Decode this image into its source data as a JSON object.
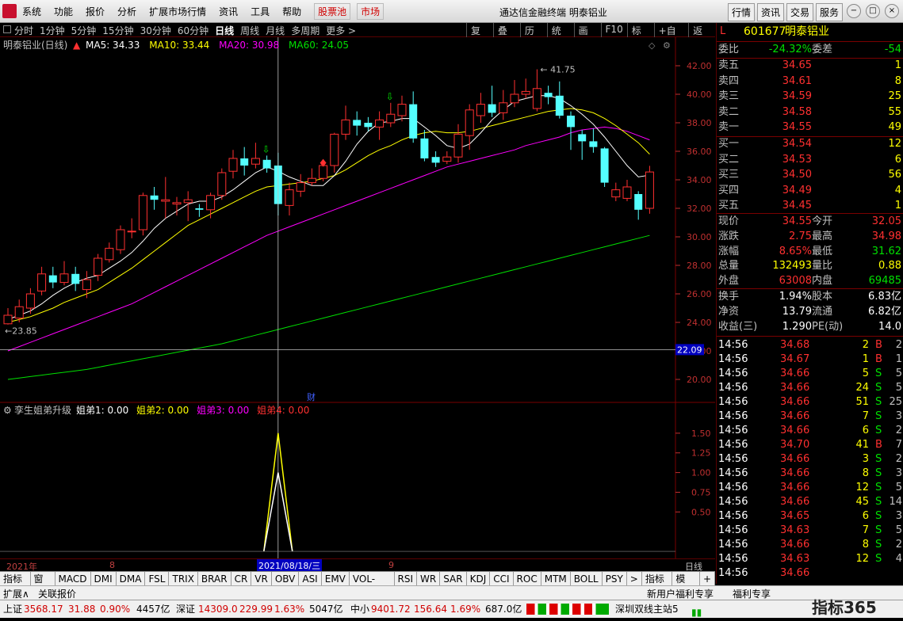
{
  "menu": {
    "items": [
      "系统",
      "功能",
      "报价",
      "分析",
      "扩展市场行情",
      "资讯",
      "工具",
      "帮助"
    ],
    "red_items": [
      "股票池",
      "市场"
    ],
    "app_title": "通达信金融终端  明泰铝业",
    "right_buttons": [
      "行情",
      "资讯",
      "交易",
      "服务"
    ]
  },
  "periods": {
    "items": [
      "分时",
      "1分钟",
      "5分钟",
      "15分钟",
      "30分钟",
      "60分钟",
      "日线",
      "周线",
      "月线",
      "多周期",
      "更多 >"
    ],
    "active": "日线",
    "tools": [
      "复权",
      "叠加",
      "历史",
      "统计",
      "画线",
      "F10",
      "标记",
      "+自选",
      "返回"
    ]
  },
  "chart_header": {
    "name": "明泰铝业(日线)",
    "ma5": "MA5: 34.33",
    "ma10": "MA10: 33.44",
    "ma20": "MA20: 30.98",
    "ma60": "MA60: 24.05"
  },
  "chart_data": [
    {
      "type": "candlestick",
      "title": "明泰铝业(日线)",
      "y_ticks": [
        "42.00",
        "40.00",
        "38.00",
        "36.00",
        "34.00",
        "32.00",
        "30.00",
        "28.00",
        "26.00",
        "24.00",
        "22.00",
        "20.00"
      ],
      "ylim": [
        19.0,
        43.0
      ],
      "cursor_price": "22.09",
      "high_label": "41.75",
      "low_label": "23.85",
      "event_label": "财",
      "x_labels": [
        "2021年",
        "8",
        "9"
      ],
      "cursor_date": "2021/08/18/三",
      "candles": [
        {
          "o": 23.9,
          "c": 24.5,
          "h": 25.0,
          "l": 23.85
        },
        {
          "o": 24.3,
          "c": 25.1,
          "h": 25.6,
          "l": 24.0
        },
        {
          "o": 25.0,
          "c": 26.0,
          "h": 26.4,
          "l": 24.6
        },
        {
          "o": 26.2,
          "c": 27.4,
          "h": 27.9,
          "l": 25.9
        },
        {
          "o": 27.3,
          "c": 26.8,
          "h": 27.9,
          "l": 26.4
        },
        {
          "o": 26.8,
          "c": 27.4,
          "h": 28.3,
          "l": 26.6
        },
        {
          "o": 27.4,
          "c": 26.7,
          "h": 27.9,
          "l": 26.2
        },
        {
          "o": 26.3,
          "c": 27.0,
          "h": 27.6,
          "l": 25.7
        },
        {
          "o": 27.3,
          "c": 28.5,
          "h": 28.8,
          "l": 26.9
        },
        {
          "o": 28.4,
          "c": 29.2,
          "h": 29.6,
          "l": 28.2
        },
        {
          "o": 29.1,
          "c": 30.5,
          "h": 30.8,
          "l": 28.8
        },
        {
          "o": 30.4,
          "c": 30.4,
          "h": 31.3,
          "l": 29.9
        },
        {
          "o": 30.5,
          "c": 32.9,
          "h": 33.1,
          "l": 30.1
        },
        {
          "o": 32.9,
          "c": 32.6,
          "h": 33.5,
          "l": 31.9
        },
        {
          "o": 32.5,
          "c": 32.6,
          "h": 34.2,
          "l": 31.3
        },
        {
          "o": 32.3,
          "c": 32.4,
          "h": 32.8,
          "l": 31.5
        },
        {
          "o": 32.4,
          "c": 32.6,
          "h": 33.2,
          "l": 31.1
        },
        {
          "o": 32.0,
          "c": 31.9,
          "h": 32.3,
          "l": 31.4
        },
        {
          "o": 31.9,
          "c": 32.9,
          "h": 33.1,
          "l": 31.3
        },
        {
          "o": 32.9,
          "c": 34.5,
          "h": 34.8,
          "l": 32.6
        },
        {
          "o": 34.6,
          "c": 35.5,
          "h": 36.1,
          "l": 34.1
        },
        {
          "o": 35.5,
          "c": 35.0,
          "h": 36.3,
          "l": 34.3
        },
        {
          "o": 35.1,
          "c": 35.5,
          "h": 36.6,
          "l": 34.8
        },
        {
          "o": 35.4,
          "c": 34.8,
          "h": 35.7,
          "l": 34.5
        },
        {
          "o": 35.0,
          "c": 32.3,
          "h": 35.9,
          "l": 31.5
        },
        {
          "o": 32.2,
          "c": 33.3,
          "h": 33.8,
          "l": 31.5
        },
        {
          "o": 33.2,
          "c": 33.8,
          "h": 34.4,
          "l": 32.8
        },
        {
          "o": 33.8,
          "c": 34.1,
          "h": 34.8,
          "l": 33.6
        },
        {
          "o": 34.1,
          "c": 35.0,
          "h": 35.3,
          "l": 33.9
        },
        {
          "o": 35.0,
          "c": 37.2,
          "h": 37.3,
          "l": 34.5
        },
        {
          "o": 37.2,
          "c": 38.2,
          "h": 39.2,
          "l": 36.8
        },
        {
          "o": 38.2,
          "c": 37.8,
          "h": 38.8,
          "l": 37.1
        },
        {
          "o": 38.0,
          "c": 37.7,
          "h": 38.4,
          "l": 37.4
        },
        {
          "o": 37.7,
          "c": 38.2,
          "h": 38.8,
          "l": 36.8
        },
        {
          "o": 38.0,
          "c": 38.6,
          "h": 39.4,
          "l": 37.7
        },
        {
          "o": 38.5,
          "c": 39.3,
          "h": 39.9,
          "l": 38.1
        },
        {
          "o": 39.3,
          "c": 36.9,
          "h": 40.2,
          "l": 36.6
        },
        {
          "o": 36.9,
          "c": 35.5,
          "h": 37.5,
          "l": 35.3
        },
        {
          "o": 35.6,
          "c": 35.2,
          "h": 36.0,
          "l": 34.9
        },
        {
          "o": 35.3,
          "c": 35.6,
          "h": 36.0,
          "l": 35.1
        },
        {
          "o": 35.6,
          "c": 37.2,
          "h": 37.9,
          "l": 35.2
        },
        {
          "o": 37.1,
          "c": 38.9,
          "h": 39.3,
          "l": 36.1
        },
        {
          "o": 38.5,
          "c": 39.3,
          "h": 40.1,
          "l": 38.0
        },
        {
          "o": 39.3,
          "c": 38.7,
          "h": 40.6,
          "l": 38.4
        },
        {
          "o": 38.7,
          "c": 39.4,
          "h": 40.3,
          "l": 38.2
        },
        {
          "o": 39.4,
          "c": 40.0,
          "h": 41.0,
          "l": 39.1
        },
        {
          "o": 40.0,
          "c": 40.2,
          "h": 41.1,
          "l": 39.7
        },
        {
          "o": 39.0,
          "c": 40.4,
          "h": 41.75,
          "l": 38.8
        },
        {
          "o": 40.1,
          "c": 39.8,
          "h": 40.6,
          "l": 39.3
        },
        {
          "o": 39.9,
          "c": 38.5,
          "h": 40.9,
          "l": 38.3
        },
        {
          "o": 38.5,
          "c": 37.7,
          "h": 38.8,
          "l": 36.1
        },
        {
          "o": 37.2,
          "c": 36.7,
          "h": 37.5,
          "l": 35.4
        },
        {
          "o": 36.7,
          "c": 36.3,
          "h": 37.6,
          "l": 35.9
        },
        {
          "o": 36.2,
          "c": 33.8,
          "h": 36.3,
          "l": 33.5
        },
        {
          "o": 32.8,
          "c": 33.3,
          "h": 33.8,
          "l": 32.5
        },
        {
          "o": 32.7,
          "c": 33.5,
          "h": 34.0,
          "l": 32.5
        },
        {
          "o": 33.0,
          "c": 31.9,
          "h": 33.2,
          "l": 31.2
        },
        {
          "o": 32.0,
          "c": 34.55,
          "h": 34.98,
          "l": 31.62
        }
      ],
      "ma5": [
        24.2,
        24.5,
        24.8,
        25.3,
        25.9,
        26.4,
        26.8,
        27.1,
        27.3,
        27.8,
        28.3,
        28.9,
        29.7,
        30.6,
        31.3,
        31.8,
        32.3,
        32.5,
        32.5,
        32.8,
        33.3,
        33.9,
        34.5,
        34.9,
        34.6,
        34.2,
        33.9,
        33.6,
        33.6,
        34.3,
        35.3,
        36.5,
        37.4,
        38.0,
        38.1,
        38.3,
        38.3,
        37.7,
        37.1,
        36.4,
        36.2,
        36.5,
        37.3,
        38.2,
        38.9,
        39.5,
        39.7,
        39.9,
        39.9,
        39.7,
        39.2,
        38.6,
        37.9,
        37.0,
        36.0,
        35.0,
        34.2,
        34.33
      ],
      "ma10": [
        24.0,
        24.2,
        24.4,
        24.7,
        25.0,
        25.4,
        25.7,
        26.0,
        26.3,
        26.8,
        27.3,
        27.8,
        28.4,
        29.0,
        29.6,
        30.2,
        30.8,
        31.2,
        31.6,
        32.0,
        32.4,
        32.8,
        33.2,
        33.5,
        33.6,
        33.7,
        33.8,
        33.9,
        34.1,
        34.3,
        34.7,
        35.2,
        35.7,
        36.1,
        36.4,
        36.8,
        37.1,
        37.3,
        37.4,
        37.3,
        37.3,
        37.4,
        37.6,
        37.8,
        38.0,
        38.2,
        38.4,
        38.6,
        38.8,
        38.9,
        39.0,
        38.9,
        38.7,
        38.3,
        37.8,
        37.2,
        36.6,
        35.8
      ],
      "ma20": [
        22.0,
        22.3,
        22.6,
        22.9,
        23.2,
        23.5,
        23.8,
        24.1,
        24.4,
        24.7,
        25.0,
        25.3,
        25.7,
        26.1,
        26.5,
        26.9,
        27.3,
        27.7,
        28.1,
        28.5,
        28.9,
        29.3,
        29.7,
        30.1,
        30.4,
        30.7,
        31.0,
        31.3,
        31.6,
        31.9,
        32.2,
        32.5,
        32.8,
        33.1,
        33.4,
        33.7,
        34.0,
        34.3,
        34.6,
        34.9,
        35.1,
        35.3,
        35.5,
        35.7,
        35.9,
        36.1,
        36.4,
        36.6,
        36.8,
        37.0,
        37.3,
        37.5,
        37.6,
        37.7,
        37.6,
        37.4,
        37.1,
        36.8
      ],
      "ma60": [
        20.0,
        20.1,
        20.2,
        20.3,
        20.4,
        20.5,
        20.6,
        20.7,
        20.85,
        21.0,
        21.15,
        21.3,
        21.45,
        21.6,
        21.75,
        21.9,
        22.05,
        22.2,
        22.35,
        22.5,
        22.7,
        22.9,
        23.1,
        23.3,
        23.5,
        23.7,
        23.9,
        24.1,
        24.3,
        24.5,
        24.7,
        24.9,
        25.1,
        25.3,
        25.5,
        25.7,
        25.9,
        26.1,
        26.3,
        26.5,
        26.7,
        26.9,
        27.1,
        27.3,
        27.5,
        27.7,
        27.9,
        28.1,
        28.3,
        28.5,
        28.7,
        28.9,
        29.1,
        29.3,
        29.5,
        29.7,
        29.9,
        30.1
      ]
    },
    {
      "type": "line",
      "title": "孪生姐弟升级",
      "legend": [
        "姐弟1: 0.00",
        "姐弟2: 0.00",
        "姐弟3: 0.00",
        "姐弟4: 0.00"
      ],
      "y_ticks": [
        "1.50",
        "1.25",
        "1.00",
        "0.75",
        "0.50"
      ],
      "ylim": [
        -0.05,
        1.7
      ],
      "spike_index": 24,
      "series": [
        {
          "name": "姐弟2",
          "values": [
            0,
            1.5,
            0
          ],
          "color": "#ffff00"
        },
        {
          "name": "姐弟1",
          "values": [
            0,
            1.0,
            0
          ],
          "color": "#ffffff"
        }
      ]
    }
  ],
  "quote": {
    "code": "601677",
    "name": "明泰铝业",
    "weibi_label": "委比",
    "weibi": "-24.32%",
    "weicha_label": "委差",
    "weicha": "-54",
    "asks": [
      {
        "label": "卖五",
        "price": "34.65",
        "vol": "1"
      },
      {
        "label": "卖四",
        "price": "34.61",
        "vol": "8"
      },
      {
        "label": "卖三",
        "price": "34.59",
        "vol": "25"
      },
      {
        "label": "卖二",
        "price": "34.58",
        "vol": "55"
      },
      {
        "label": "卖一",
        "price": "34.55",
        "vol": "49"
      }
    ],
    "bids": [
      {
        "label": "买一",
        "price": "34.54",
        "vol": "12"
      },
      {
        "label": "买二",
        "price": "34.53",
        "vol": "6"
      },
      {
        "label": "买三",
        "price": "34.50",
        "vol": "56"
      },
      {
        "label": "买四",
        "price": "34.49",
        "vol": "4"
      },
      {
        "label": "买五",
        "price": "34.45",
        "vol": "1"
      }
    ],
    "stats1": [
      {
        "a": "现价",
        "b": "34.55",
        "bc": "red",
        "c": "今开",
        "d": "32.05",
        "dc": "red"
      },
      {
        "a": "涨跌",
        "b": "2.75",
        "bc": "red",
        "c": "最高",
        "d": "34.98",
        "dc": "red"
      },
      {
        "a": "涨幅",
        "b": "8.65%",
        "bc": "red",
        "c": "最低",
        "d": "31.62",
        "dc": "green"
      },
      {
        "a": "总量",
        "b": "132493",
        "bc": "yellow",
        "c": "量比",
        "d": "0.88",
        "dc": "yellow"
      },
      {
        "a": "外盘",
        "b": "63008",
        "bc": "red",
        "c": "内盘",
        "d": "69485",
        "dc": "green"
      }
    ],
    "stats2": [
      {
        "a": "换手",
        "b": "1.94%",
        "bc": "white",
        "c": "股本",
        "d": "6.83亿",
        "dc": "white"
      },
      {
        "a": "净资",
        "b": "13.79",
        "bc": "white",
        "c": "流通",
        "d": "6.82亿",
        "dc": "white"
      },
      {
        "a": "收益(三)",
        "b": "1.290",
        "bc": "white",
        "c": "PE(动)",
        "d": "14.0",
        "dc": "white"
      }
    ],
    "trades": [
      {
        "t": "14:56",
        "p": "34.68",
        "v": "2",
        "bs": "B",
        "n": "2"
      },
      {
        "t": "14:56",
        "p": "34.67",
        "v": "1",
        "bs": "B",
        "n": "1"
      },
      {
        "t": "14:56",
        "p": "34.66",
        "v": "5",
        "bs": "S",
        "n": "5"
      },
      {
        "t": "14:56",
        "p": "34.66",
        "v": "24",
        "bs": "S",
        "n": "5"
      },
      {
        "t": "14:56",
        "p": "34.66",
        "v": "51",
        "bs": "S",
        "n": "25"
      },
      {
        "t": "14:56",
        "p": "34.66",
        "v": "7",
        "bs": "S",
        "n": "3"
      },
      {
        "t": "14:56",
        "p": "34.66",
        "v": "6",
        "bs": "S",
        "n": "2"
      },
      {
        "t": "14:56",
        "p": "34.70",
        "v": "41",
        "bs": "B",
        "n": "7"
      },
      {
        "t": "14:56",
        "p": "34.66",
        "v": "3",
        "bs": "S",
        "n": "2"
      },
      {
        "t": "14:56",
        "p": "34.66",
        "v": "8",
        "bs": "S",
        "n": "3"
      },
      {
        "t": "14:56",
        "p": "34.66",
        "v": "12",
        "bs": "S",
        "n": "5"
      },
      {
        "t": "14:56",
        "p": "34.66",
        "v": "45",
        "bs": "S",
        "n": "14"
      },
      {
        "t": "14:56",
        "p": "34.65",
        "v": "6",
        "bs": "S",
        "n": "3"
      },
      {
        "t": "14:56",
        "p": "34.63",
        "v": "7",
        "bs": "S",
        "n": "5"
      },
      {
        "t": "14:56",
        "p": "34.66",
        "v": "8",
        "bs": "S",
        "n": "2"
      },
      {
        "t": "14:56",
        "p": "34.63",
        "v": "12",
        "bs": "S",
        "n": "4"
      },
      {
        "t": "14:56",
        "p": "34.66",
        "v": "",
        "bs": "",
        "n": ""
      }
    ]
  },
  "tabs": [
    "指标A",
    "窗口",
    "MACD",
    "DMI",
    "DMA",
    "FSL",
    "TRIX",
    "BRAR",
    "CR",
    "VR",
    "OBV",
    "ASI",
    "EMV",
    "VOL-TDX",
    "RSI",
    "WR",
    "SAR",
    "KDJ",
    "CCI",
    "ROC",
    "MTM",
    "BOLL",
    "PSY",
    ">"
  ],
  "tabs_right": [
    "指标B",
    "模 板",
    "+"
  ],
  "tabs_row2": [
    "扩展∧",
    "关联报价"
  ],
  "promo": [
    "新用户福利专享",
    "福利专享"
  ],
  "status": {
    "sh_label": "上证",
    "sh_val": "3568.17",
    "sh_chg": "31.88",
    "sh_pct": "0.90%",
    "sh_amt": "4457亿",
    "sz_label": "深证",
    "sz_val": "14309.0",
    "sz_chg": "229.99",
    "sz_pct": "1.63%",
    "sz_amt": "5047亿",
    "zx_label": "中小",
    "zx_val": "9401.72",
    "zx_chg": "156.64",
    "zx_pct": "1.69%",
    "zx_amt": "687.0亿",
    "server": "深圳双线主站5",
    "brand": "指标365"
  },
  "colors": {
    "up": "#ff3030",
    "down": "#54ffff",
    "ma5": "#ffffff",
    "ma10": "#ffff00",
    "ma20": "#ff00ff",
    "ma60": "#00e000"
  }
}
